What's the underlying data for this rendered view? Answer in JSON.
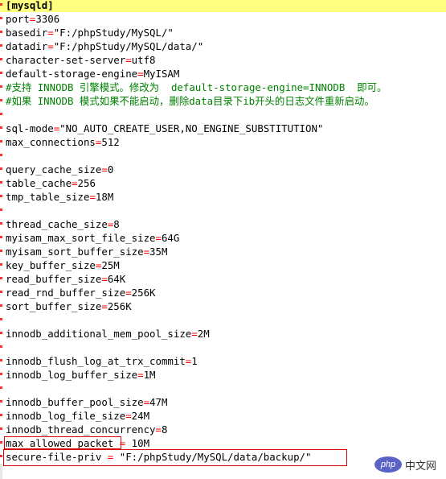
{
  "editor": {
    "lines": [
      "[mysqld]",
      "port=3306",
      "basedir=\"F:/phpStudy/MySQL/\"",
      "datadir=\"F:/phpStudy/MySQL/data/\"",
      "character-set-server=utf8",
      "default-storage-engine=MyISAM",
      "#支持 INNODB 引擎模式。修改为  default-storage-engine=INNODB  即可。",
      "#如果 INNODB 模式如果不能启动，删除data目录下ib开头的日志文件重新启动。",
      "",
      "sql-mode=\"NO_AUTO_CREATE_USER,NO_ENGINE_SUBSTITUTION\"",
      "max_connections=512",
      "",
      "query_cache_size=0",
      "table_cache=256",
      "tmp_table_size=18M",
      "",
      "thread_cache_size=8",
      "myisam_max_sort_file_size=64G",
      "myisam_sort_buffer_size=35M",
      "key_buffer_size=25M",
      "read_buffer_size=64K",
      "read_rnd_buffer_size=256K",
      "sort_buffer_size=256K",
      "",
      "innodb_additional_mem_pool_size=2M",
      "",
      "innodb_flush_log_at_trx_commit=1",
      "innodb_log_buffer_size=1M",
      "",
      "innodb_buffer_pool_size=47M",
      "innodb_log_file_size=24M",
      "innodb_thread_concurrency=8",
      "max_allowed_packet = 10M",
      "secure-file-priv = \"F:/phpStudy/MySQL/data/backup/\""
    ]
  },
  "watermark": {
    "logo_text": "php",
    "site_text": "中文网"
  },
  "colors": {
    "section_highlight": "#ffff80",
    "comment": "#008000",
    "operator": "#ff0000",
    "annotation_box": "#d80000"
  }
}
